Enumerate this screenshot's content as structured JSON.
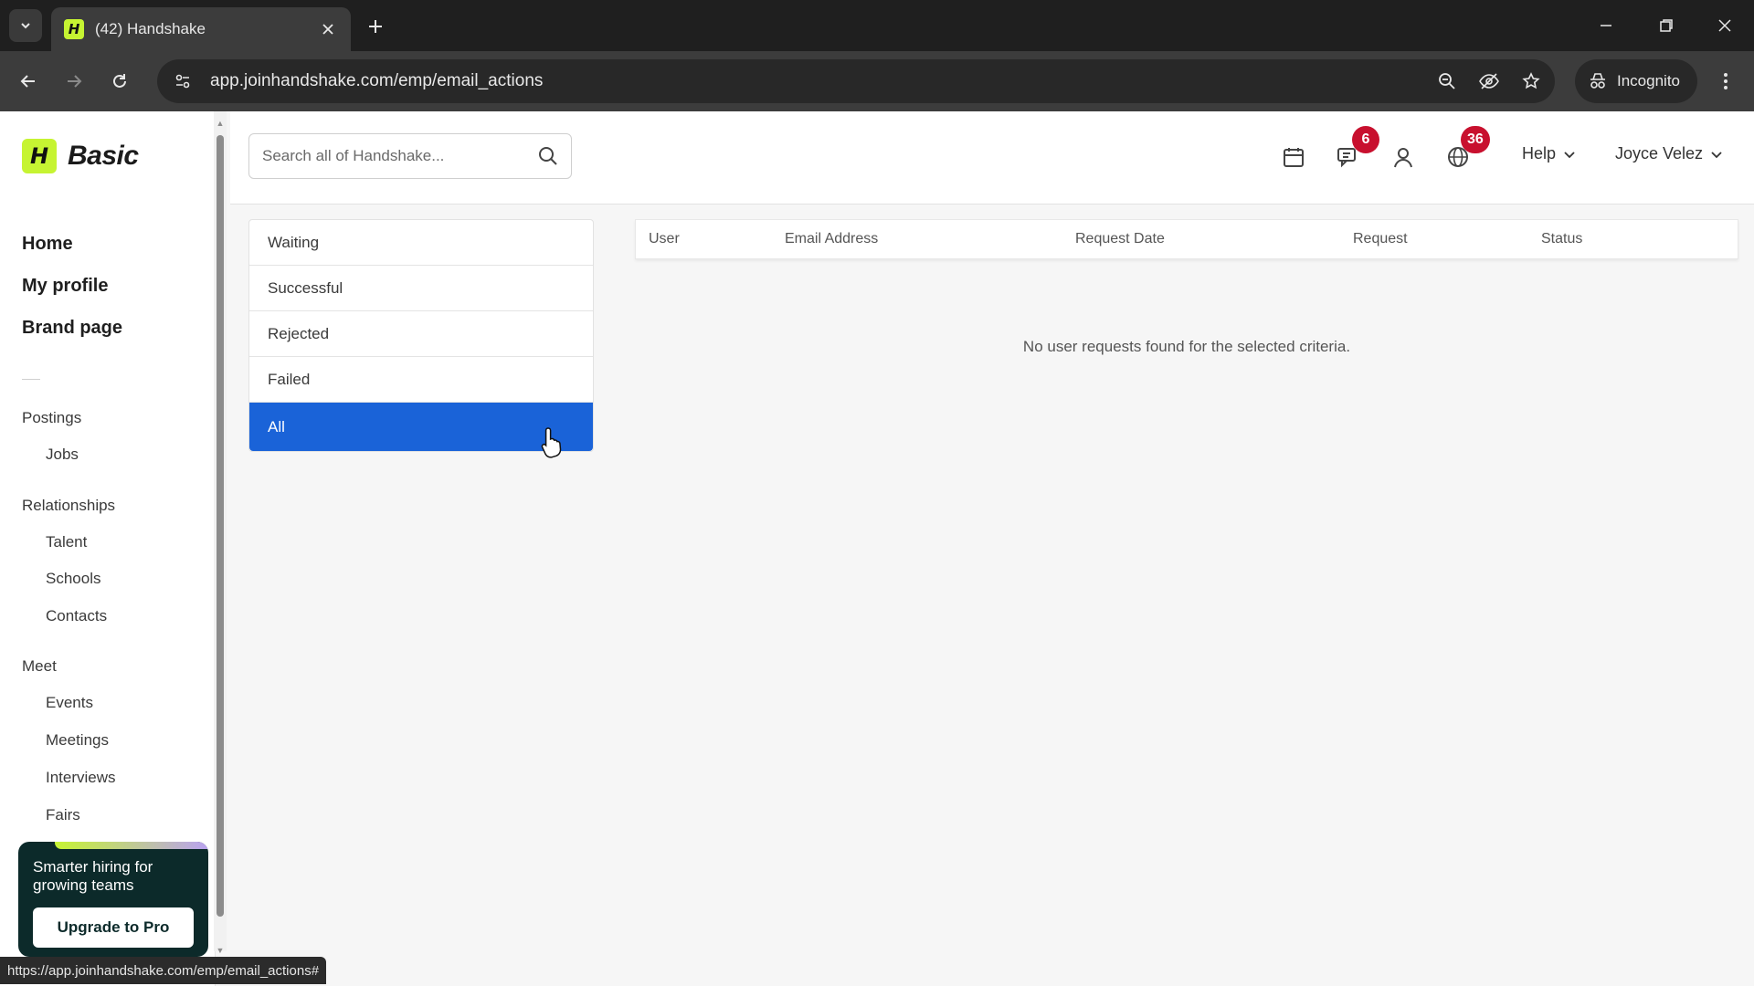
{
  "browser": {
    "tab_title": "(42) Handshake",
    "url": "app.joinhandshake.com/emp/email_actions",
    "incognito_label": "Incognito",
    "status_url": "https://app.joinhandshake.com/emp/email_actions#"
  },
  "brand": {
    "logo_letter": "H",
    "plan": "Basic",
    "accent": "#c6f432"
  },
  "search": {
    "placeholder": "Search all of Handshake..."
  },
  "header": {
    "messages_badge": "6",
    "globe_badge": "36",
    "help_label": "Help",
    "user_name": "Joyce Velez",
    "badge_color": "#c8102e"
  },
  "sidebar": {
    "main": [
      "Home",
      "My profile",
      "Brand page"
    ],
    "postings_label": "Postings",
    "postings_items": [
      "Jobs"
    ],
    "relationships_label": "Relationships",
    "relationships_items": [
      "Talent",
      "Schools",
      "Contacts"
    ],
    "meet_label": "Meet",
    "meet_items": [
      "Events",
      "Meetings",
      "Interviews",
      "Fairs"
    ],
    "promo_text": "Smarter hiring for growing teams",
    "promo_button": "Upgrade to Pro"
  },
  "filters": {
    "items": [
      "Waiting",
      "Successful",
      "Rejected",
      "Failed",
      "All"
    ],
    "selected": "All",
    "selected_color": "#1a63d8"
  },
  "table": {
    "columns": [
      "User",
      "Email Address",
      "Request Date",
      "Request",
      "Status"
    ],
    "empty_message": "No user requests found for the selected criteria."
  }
}
